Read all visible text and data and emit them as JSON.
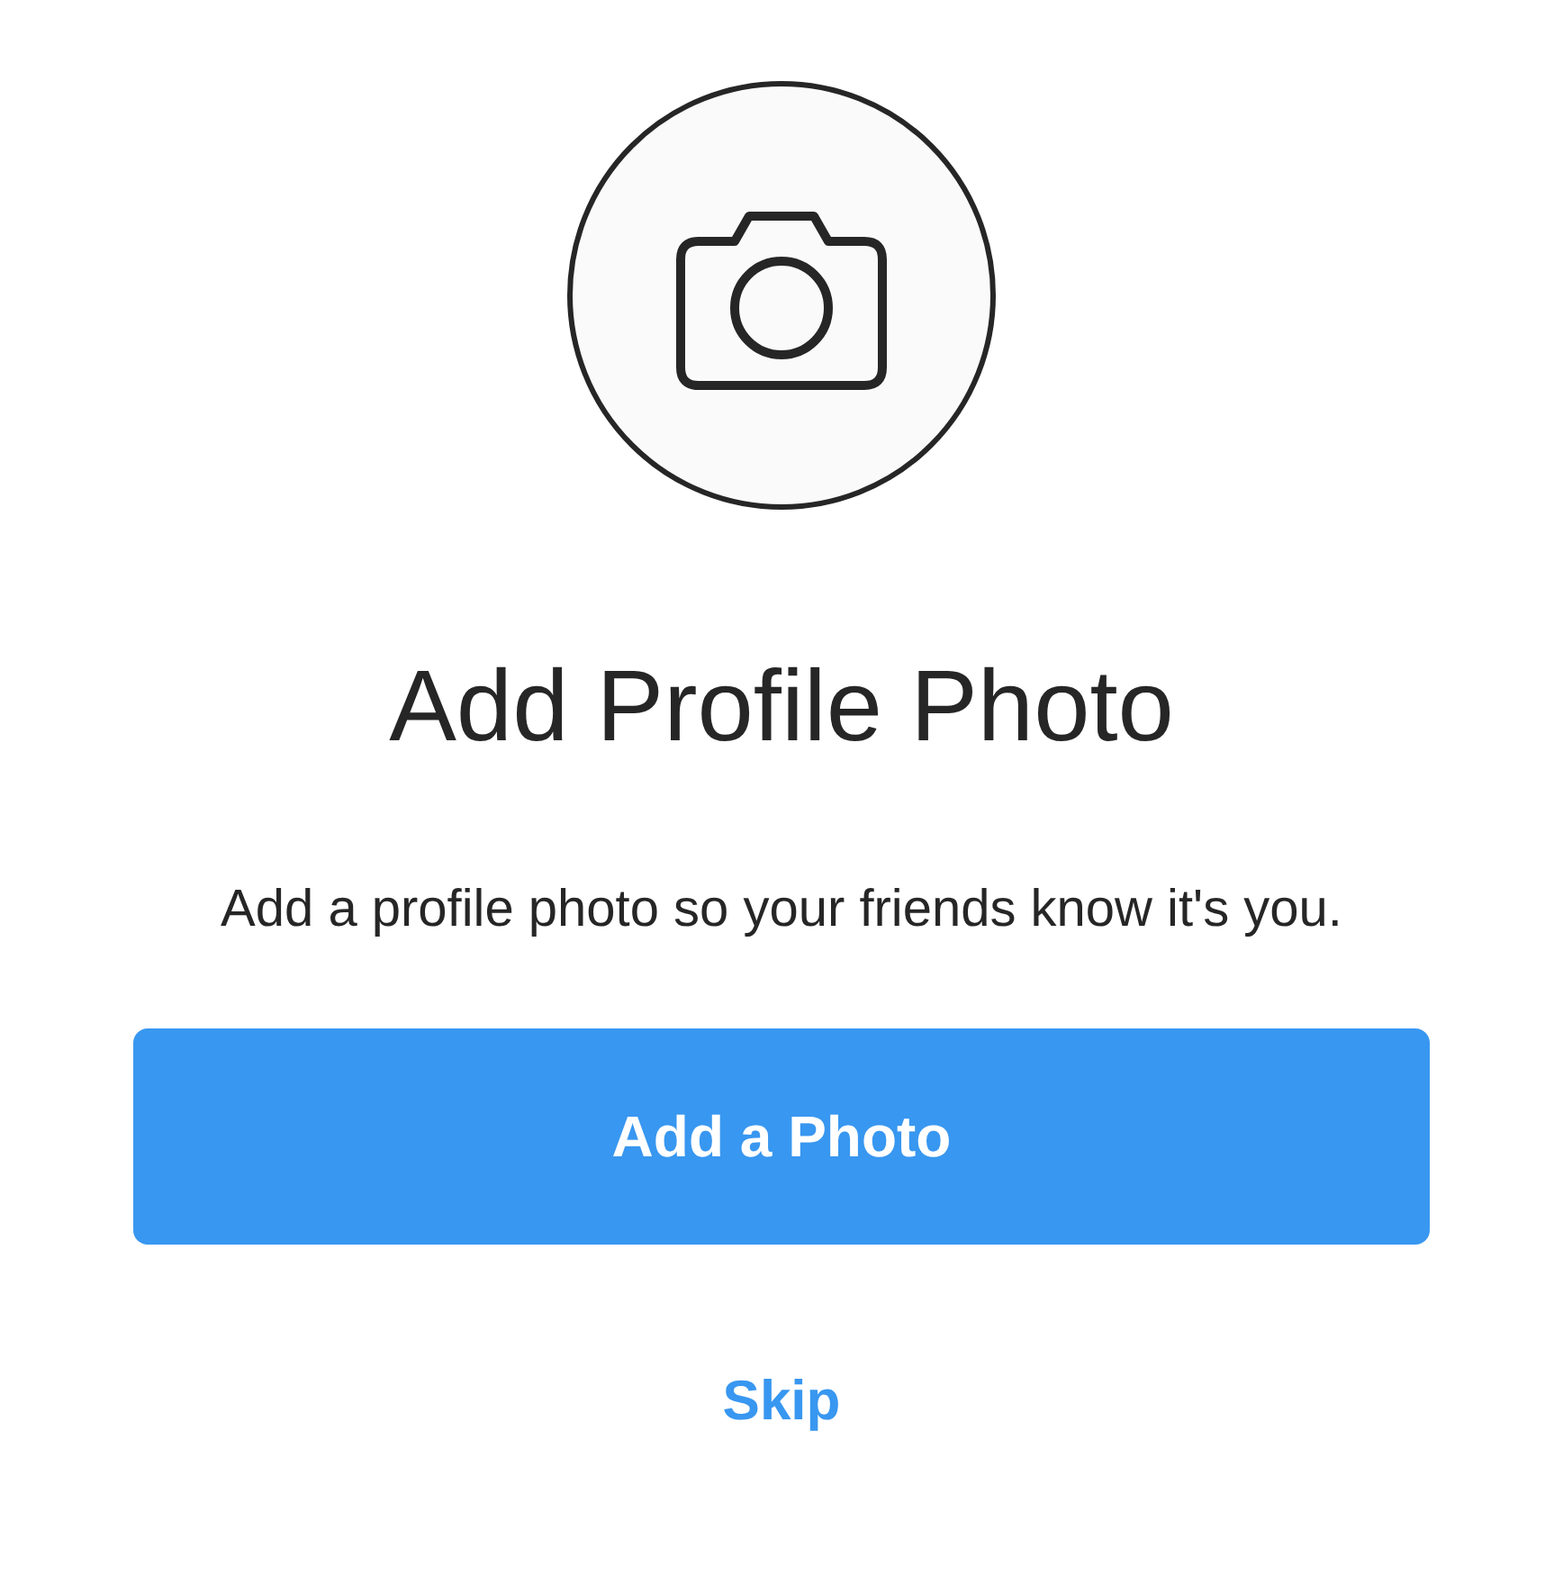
{
  "title": "Add Profile Photo",
  "description": "Add a profile photo so your friends know it's you.",
  "primary_button": "Add a Photo",
  "skip_link": "Skip"
}
